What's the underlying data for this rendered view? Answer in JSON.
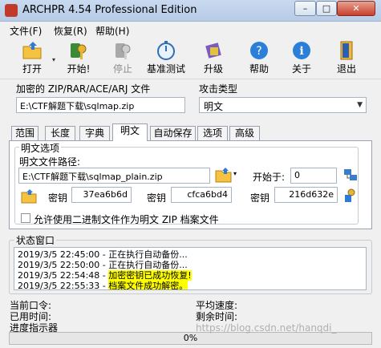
{
  "window": {
    "title": "ARCHPR 4.54 Professional Edition",
    "min_glyph": "–",
    "max_glyph": "□",
    "close_glyph": "✕"
  },
  "menu": [
    {
      "label": "文件(F)"
    },
    {
      "label": "恢复(R)"
    },
    {
      "label": "帮助(H)"
    }
  ],
  "toolbar": {
    "open": "打开",
    "start": "开始!",
    "stop": "停止",
    "benchmark": "基准测试",
    "upgrade": "升级",
    "help": "帮助",
    "about": "关于",
    "exit": "退出",
    "dropdown_glyph": "▾"
  },
  "file_section": {
    "label": "加密的 ZIP/RAR/ACE/ARJ 文件",
    "value": "E:\\CTF解题下载\\sqlmap.zip"
  },
  "attack": {
    "label": "攻击类型",
    "value": "明文",
    "caret": "▼"
  },
  "tabs": [
    {
      "label": "范围"
    },
    {
      "label": "长度"
    },
    {
      "label": "字典"
    },
    {
      "label": "明文"
    },
    {
      "label": "自动保存"
    },
    {
      "label": "选项"
    },
    {
      "label": "高级"
    }
  ],
  "active_tab": "明文",
  "plaintext": {
    "group_title": "明文选项",
    "path_label": "明文文件路径:",
    "path_value": "E:\\CTF解题下载\\sqlmap_plain.zip",
    "start_label": "开始于:",
    "start_value": "0",
    "key_label": "密钥",
    "keys": [
      "37ea6b6d",
      "cfca6bd4",
      "216d632e"
    ],
    "checkbox_label": "允许使用二进制文件作为明文 ZIP 档案文件"
  },
  "status": {
    "title": "状态窗口",
    "lines": [
      {
        "time": "2019/3/5 22:45:00 - ",
        "text": "正在执行自动备份...",
        "highlight": false
      },
      {
        "time": "2019/3/5 22:50:00 - ",
        "text": "正在执行自动备份...",
        "highlight": false
      },
      {
        "time": "2019/3/5 22:54:48 - ",
        "text": "加密密钥已成功恢复!",
        "highlight": true
      },
      {
        "time": "2019/3/5 22:55:33 - ",
        "text": "档案文件成功解密。",
        "highlight": true
      }
    ]
  },
  "stats": {
    "current_password": "当前口令:",
    "elapsed": "已用时间:",
    "progress_label": "进度指示器",
    "avg_speed": "平均速度:",
    "remaining": "剩余时间:"
  },
  "progress": {
    "text": "0%",
    "value": 0
  },
  "watermark": "https://blog.csdn.net/hanqdi_"
}
